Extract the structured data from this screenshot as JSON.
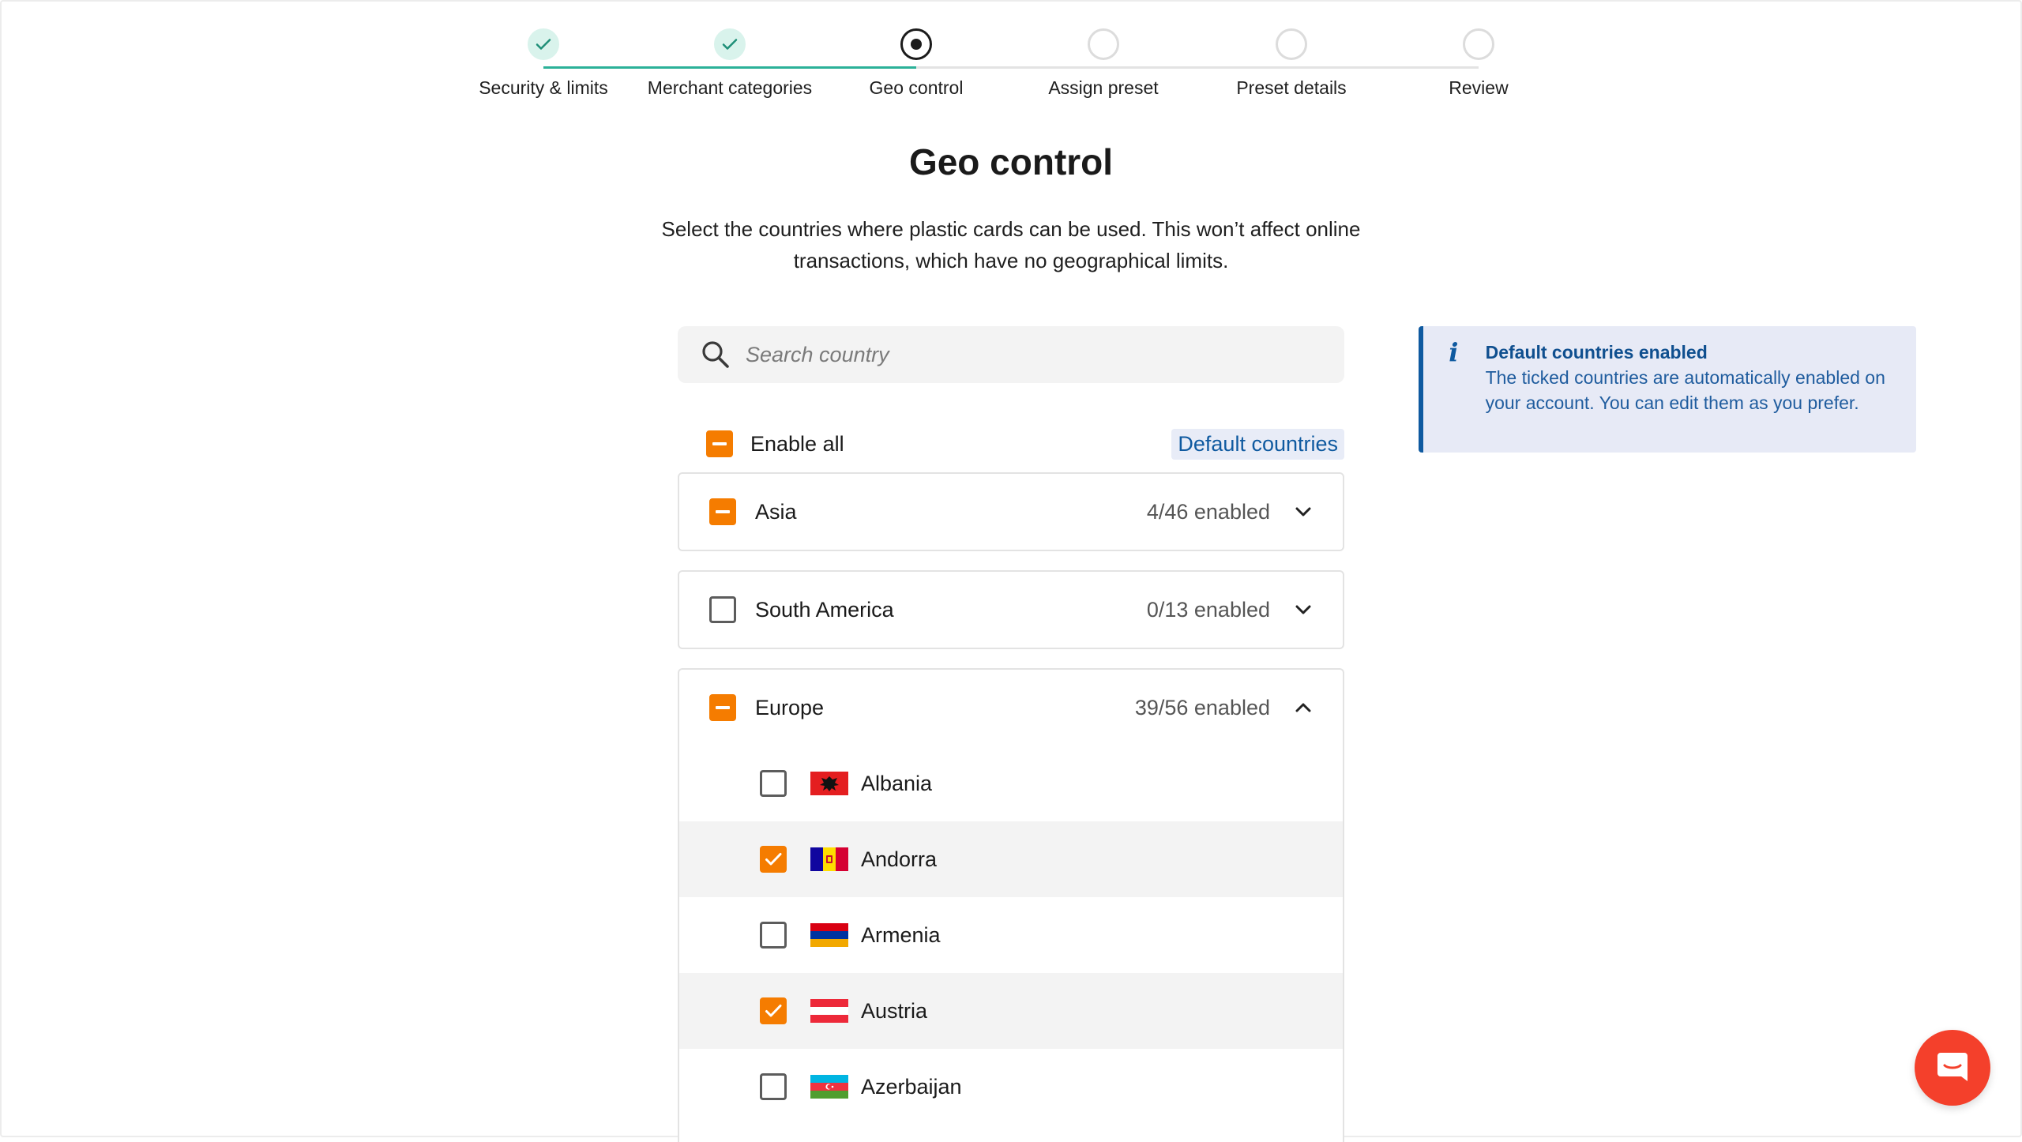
{
  "stepper": {
    "steps": [
      {
        "label": "Security & limits",
        "state": "done"
      },
      {
        "label": "Merchant categories",
        "state": "done"
      },
      {
        "label": "Geo control",
        "state": "current"
      },
      {
        "label": "Assign preset",
        "state": "upcoming"
      },
      {
        "label": "Preset details",
        "state": "upcoming"
      },
      {
        "label": "Review",
        "state": "upcoming"
      }
    ]
  },
  "page": {
    "title": "Geo control",
    "subtitle": "Select the countries where plastic cards can be used. This won’t affect online transactions, which have no geographical limits."
  },
  "search": {
    "placeholder": "Search country",
    "value": ""
  },
  "enable_all": {
    "label": "Enable all",
    "state": "partial"
  },
  "default_countries_label": "Default countries",
  "regions": [
    {
      "name": "Asia",
      "count": "4/46 enabled",
      "state": "partial",
      "expanded": false
    },
    {
      "name": "South America",
      "count": "0/13 enabled",
      "state": "unchecked",
      "expanded": false
    },
    {
      "name": "Europe",
      "count": "39/56 enabled",
      "state": "partial",
      "expanded": true,
      "countries": [
        {
          "name": "Albania",
          "checked": false,
          "flag": "albania-flag-icon"
        },
        {
          "name": "Andorra",
          "checked": true,
          "flag": "andorra-flag-icon"
        },
        {
          "name": "Armenia",
          "checked": false,
          "flag": "armenia-flag-icon"
        },
        {
          "name": "Austria",
          "checked": true,
          "flag": "austria-flag-icon"
        },
        {
          "name": "Azerbaijan",
          "checked": false,
          "flag": "azerbaijan-flag-icon"
        }
      ]
    }
  ],
  "info": {
    "title": "Default countries enabled",
    "text": "The ticked countries are automatically enabled on your account. You can edit them as you prefer."
  },
  "colors": {
    "accent": "#f57c00",
    "done": "#2bb198",
    "info": "#0f5aa0",
    "chat": "#f4402b"
  },
  "icons": {
    "search": "search-icon",
    "info": "info-icon",
    "chat": "chat-icon",
    "check": "check-icon",
    "chevron_down": "chevron-down-icon",
    "chevron_up": "chevron-up-icon"
  }
}
